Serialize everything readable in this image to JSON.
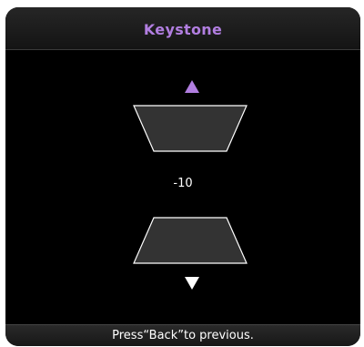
{
  "title": "Keystone",
  "value": "-10",
  "footer": "Press“Back”to previous.",
  "colors": {
    "accent": "#b17ee0",
    "panel": "#000000",
    "shape_fill": "#333333",
    "shape_stroke": "#ffffff"
  },
  "icons": {
    "up": "triangle-up-icon",
    "down": "triangle-down-icon"
  }
}
